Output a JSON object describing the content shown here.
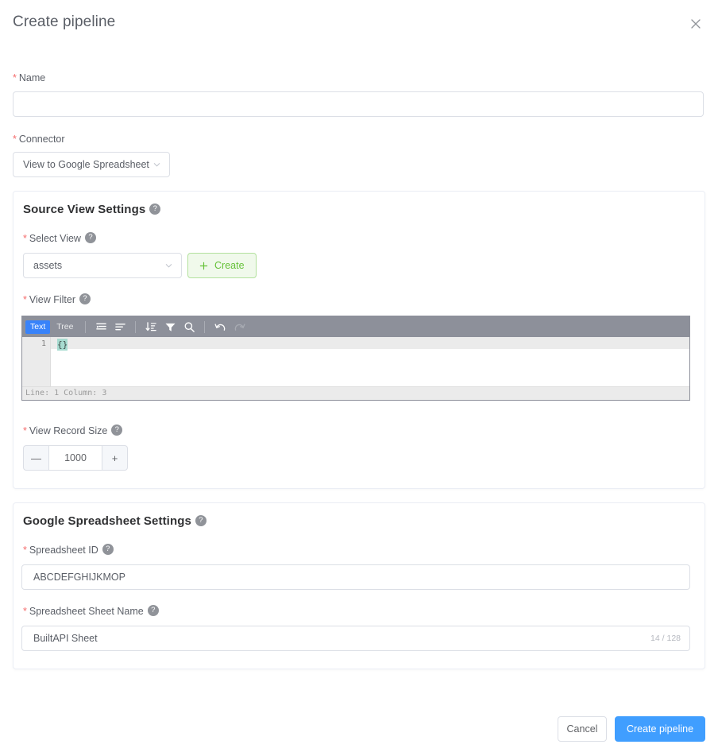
{
  "dialog": {
    "title": "Create pipeline",
    "close_icon": "close-icon"
  },
  "form": {
    "name": {
      "label": "Name",
      "required": true,
      "value": "",
      "placeholder": ""
    },
    "connector": {
      "label": "Connector",
      "required": true,
      "value": "View to Google Spreadsheet",
      "options": [
        "View to Google Spreadsheet"
      ]
    }
  },
  "source_view_panel": {
    "title": "Source View Settings",
    "help_icon": "help-icon",
    "select_view": {
      "label": "Select View",
      "required": true,
      "value": "assets",
      "options": [
        "assets"
      ],
      "create_button": {
        "label": "Create",
        "plus_icon": "plus-icon"
      }
    },
    "view_filter": {
      "label": "View Filter",
      "required": true,
      "editor": {
        "tabs": [
          {
            "label": "Text",
            "active": true
          },
          {
            "label": "Tree",
            "active": false
          }
        ],
        "toolbar_icons": [
          "format-compact-icon",
          "format-indent-icon",
          "sort-icon",
          "filter-icon",
          "search-icon",
          "undo-icon",
          "redo-icon"
        ],
        "line_number": "1",
        "content": "{}",
        "status": "Line: 1  Column: 3"
      }
    },
    "view_record_size": {
      "label": "View Record Size",
      "required": true,
      "value": "1000",
      "minus_label": "—",
      "plus_label": "+"
    }
  },
  "spreadsheet_panel": {
    "title": "Google Spreadsheet Settings",
    "help_icon": "help-icon",
    "spreadsheet_id": {
      "label": "Spreadsheet ID",
      "required": true,
      "value": "ABCDEFGHIJKMOP",
      "placeholder": ""
    },
    "sheet_name": {
      "label": "Spreadsheet Sheet Name",
      "required": true,
      "value": "BuiltAPI Sheet",
      "placeholder": "",
      "counter": "14 / 128"
    }
  },
  "footer": {
    "cancel_label": "Cancel",
    "submit_label": "Create pipeline"
  },
  "colors": {
    "primary": "#409eff",
    "required_star": "#f56c6c",
    "success": "#67c23a",
    "editor_toolbar": "#8d909a",
    "editor_tab_active": "#3883fa",
    "selection": "#a7dbd0"
  }
}
